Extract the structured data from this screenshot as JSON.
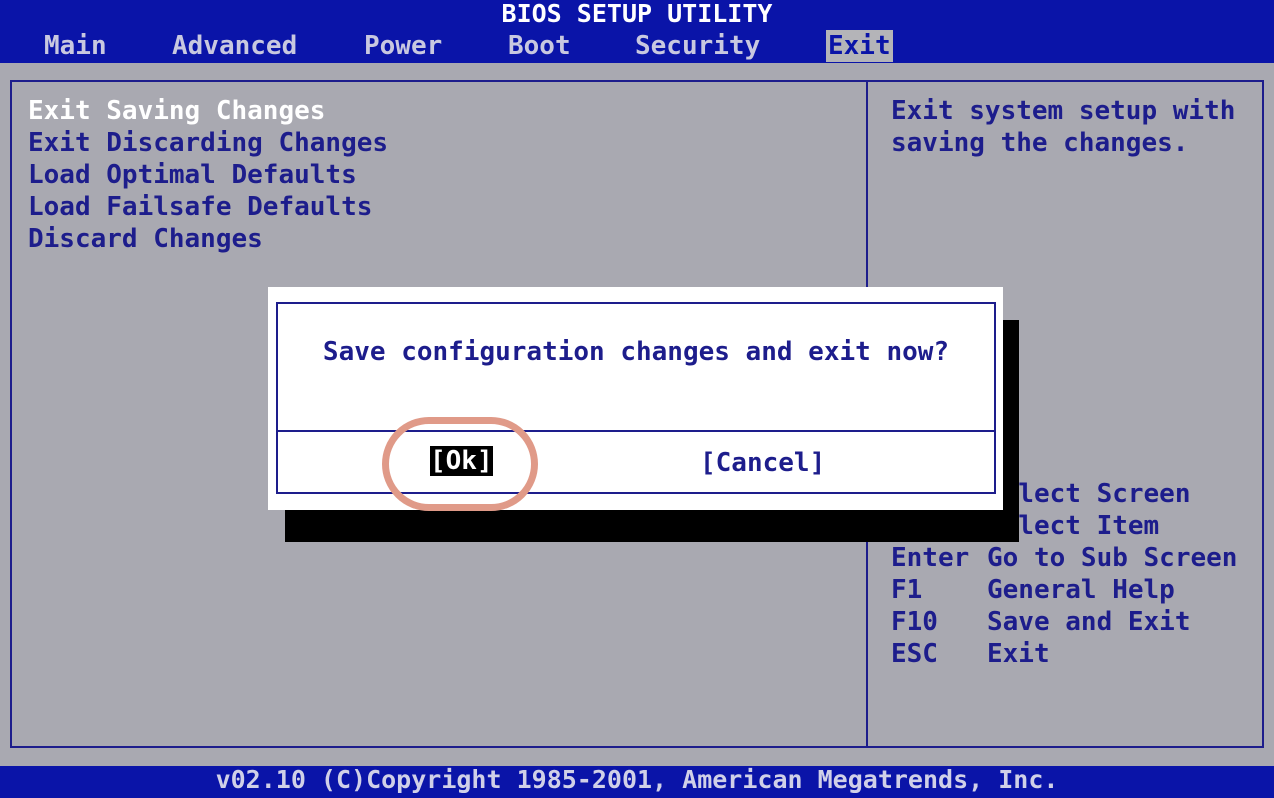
{
  "header": {
    "title": "BIOS SETUP UTILITY",
    "tabs": [
      "Main",
      "Advanced",
      "Power",
      "Boot",
      "Security",
      "Exit"
    ],
    "active_tab": "Exit"
  },
  "menu": {
    "items": [
      "Exit Saving Changes",
      "Exit Discarding Changes",
      "Load Optimal Defaults",
      "Load Failsafe Defaults",
      "Discard Changes"
    ],
    "selected": "Exit Saving Changes"
  },
  "help": {
    "description_lines": [
      "Exit system setup with",
      "saving the changes."
    ],
    "keys": [
      {
        "key": "←→",
        "action": "Select Screen"
      },
      {
        "key": "↑↓",
        "action": "Select Item"
      },
      {
        "key": "Enter",
        "action": "Go to Sub Screen"
      },
      {
        "key": "F1",
        "action": "General Help"
      },
      {
        "key": "F10",
        "action": "Save and Exit"
      },
      {
        "key": "ESC",
        "action": "Exit"
      }
    ]
  },
  "dialog": {
    "message": "Save configuration changes and exit now?",
    "ok_label": "[Ok]",
    "cancel_label": "[Cancel]"
  },
  "footer": {
    "copyright": "v02.10 (C)Copyright 1985-2001, American Megatrends, Inc."
  },
  "colors": {
    "header_bg": "#0a14a8",
    "body_bg": "#a9a9b1",
    "text": "#1d1d8c",
    "annotation": "#e09a88"
  }
}
